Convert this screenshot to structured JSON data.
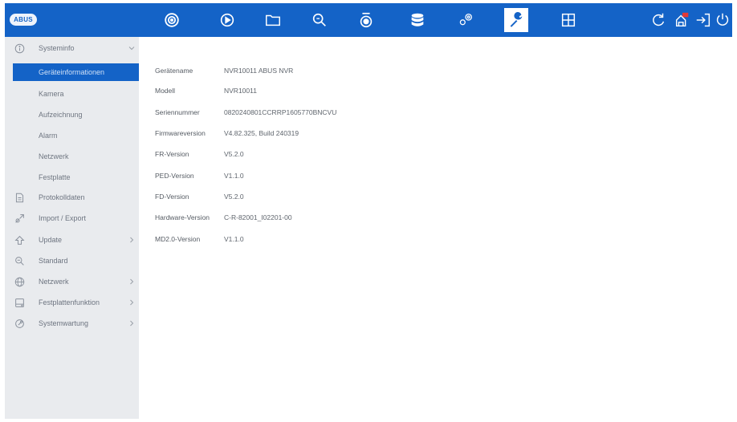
{
  "brand": {
    "logo_text": "ABUS",
    "accent": "#1463c7"
  },
  "topbar": {
    "icons": [
      "live-view-icon",
      "playback-icon",
      "files-icon",
      "search-icon",
      "camera-icon",
      "storage-icon",
      "settings-icon",
      "maintenance-icon",
      "layout-icon",
      "refresh-icon",
      "alarm-icon",
      "logout-icon",
      "power-icon"
    ],
    "active": "maintenance-icon"
  },
  "sidebar": {
    "systeminfo": {
      "label": "Systeminfo",
      "children": [
        {
          "label": "Geräteinformationen",
          "selected": true
        },
        {
          "label": "Kamera"
        },
        {
          "label": "Aufzeichnung"
        },
        {
          "label": "Alarm"
        },
        {
          "label": "Netzwerk"
        },
        {
          "label": "Festplatte"
        }
      ]
    },
    "items": [
      {
        "label": "Protokolldaten",
        "icon": "log-icon"
      },
      {
        "label": "Import / Export",
        "icon": "import-export-icon"
      },
      {
        "label": "Update",
        "icon": "update-icon",
        "has_children": true
      },
      {
        "label": "Standard",
        "icon": "default-icon"
      },
      {
        "label": "Netzwerk",
        "icon": "network-icon",
        "has_children": true
      },
      {
        "label": "Festplattenfunktion",
        "icon": "hdd-icon",
        "has_children": true
      },
      {
        "label": "Systemwartung",
        "icon": "system-maintenance-icon",
        "has_children": true
      }
    ]
  },
  "device_info": [
    {
      "key": "Gerätename",
      "value": "NVR10011 ABUS NVR"
    },
    {
      "key": "Modell",
      "value": "NVR10011"
    },
    {
      "key": "Seriennummer",
      "value": "0820240801CCRRP1605770BNCVU"
    },
    {
      "key": "Firmwareversion",
      "value": "V4.82.325, Build 240319"
    },
    {
      "key": "FR-Version",
      "value": "V5.2.0"
    },
    {
      "key": "PED-Version",
      "value": "V1.1.0"
    },
    {
      "key": "FD-Version",
      "value": "V5.2.0"
    },
    {
      "key": "Hardware-Version",
      "value": "C-R-82001_I02201-00"
    },
    {
      "key": "MD2.0-Version",
      "value": "V1.1.0"
    }
  ]
}
